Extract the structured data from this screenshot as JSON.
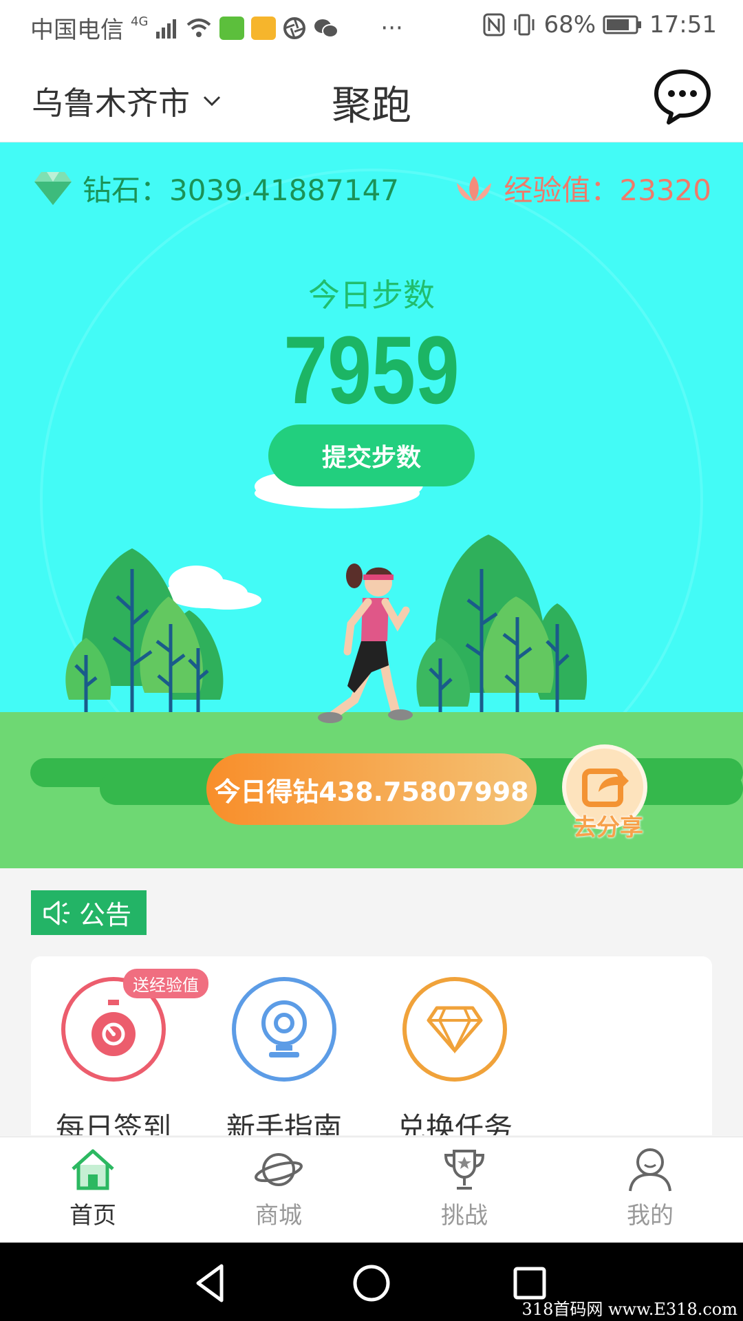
{
  "status_bar": {
    "carrier": "中国电信",
    "network": "4G",
    "dots": "···",
    "battery": "68%",
    "time": "17:51"
  },
  "header": {
    "city": "乌鲁木齐市",
    "title": "聚跑"
  },
  "hero": {
    "diamond_text": "钻石：3039.41887147",
    "exp_text": "经验值：23320",
    "steps_label": "今日步数",
    "steps_value": "7959",
    "submit_label": "提交步数",
    "earn_label": "今日得钻438.75807998",
    "share_label": "去分享"
  },
  "notice": {
    "label": "公告"
  },
  "features": [
    {
      "label": "每日签到",
      "badge": "送经验值",
      "icon": "stopwatch-icon",
      "color": "#ec5d6d"
    },
    {
      "label": "新手指南",
      "icon": "guide-icon",
      "color": "#5c9ce6"
    },
    {
      "label": "兑换任务",
      "icon": "gem-icon",
      "color": "#f0a23a"
    }
  ],
  "tabs": [
    {
      "label": "首页",
      "icon": "home-icon",
      "active": true
    },
    {
      "label": "商城",
      "icon": "planet-icon",
      "active": false
    },
    {
      "label": "挑战",
      "icon": "trophy-icon",
      "active": false
    },
    {
      "label": "我的",
      "icon": "user-icon",
      "active": false
    }
  ],
  "watermark": "318首码网  www.E318.com",
  "colors": {
    "brand_green": "#22cf7e",
    "hero_bg": "#43fbf6",
    "grass": "#6ed873",
    "earn_gradient_start": "#f88e2a",
    "earn_gradient_end": "#f4c275",
    "exp_color": "#ef7a6a"
  }
}
